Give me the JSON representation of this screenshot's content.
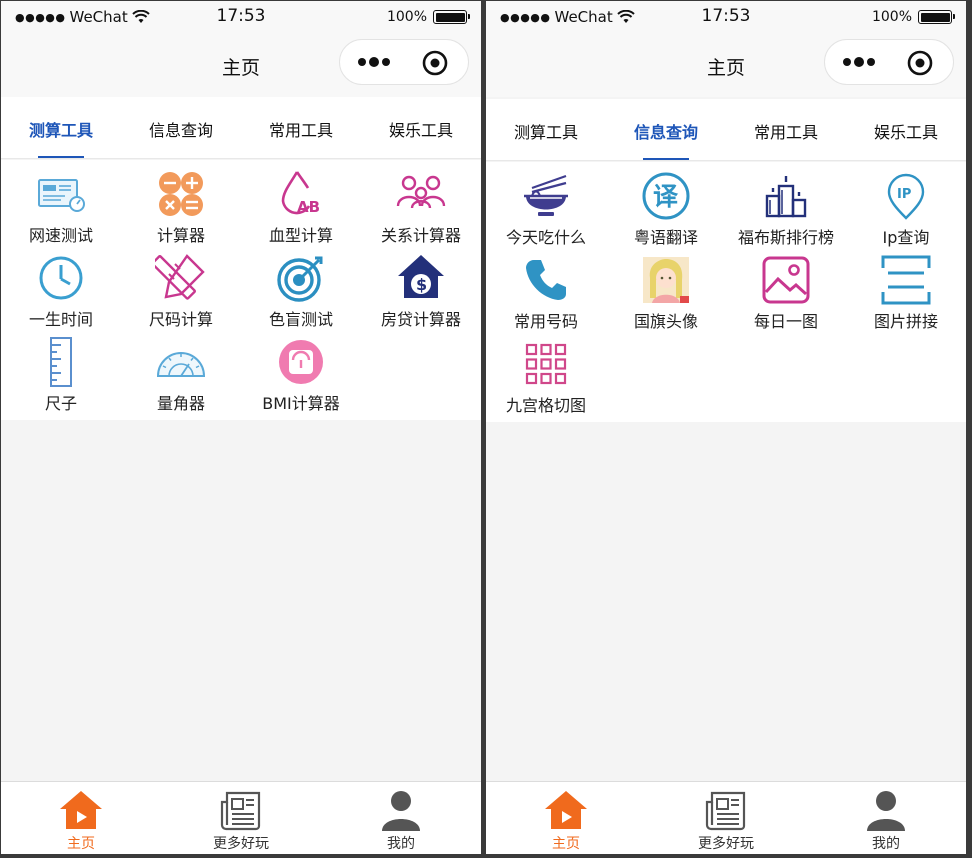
{
  "status_bar": {
    "signal": "●●●●●",
    "carrier": "WeChat",
    "time": "17:53",
    "battery": "100%",
    "signal_icon": "signal-dots-icon",
    "wifi_icon": "wifi-icon",
    "battery_icon": "battery-icon"
  },
  "nav": {
    "title": "主页",
    "more_icon": "more-dots-icon",
    "target_icon": "target-icon"
  },
  "tabs": [
    "测算工具",
    "信息查询",
    "常用工具",
    "娱乐工具"
  ],
  "left_screen": {
    "active_tab": "测算工具",
    "items": [
      {
        "label": "网速测试",
        "icon": "speed-test-icon"
      },
      {
        "label": "计算器",
        "icon": "calculator-icon"
      },
      {
        "label": "血型计算",
        "icon": "blood-type-icon"
      },
      {
        "label": "关系计算器",
        "icon": "family-icon"
      },
      {
        "label": "一生时间",
        "icon": "clock-icon"
      },
      {
        "label": "尺码计算",
        "icon": "ruler-pencil-icon"
      },
      {
        "label": "色盲测试",
        "icon": "target-dartboard-icon"
      },
      {
        "label": "房贷计算器",
        "icon": "house-dollar-icon"
      },
      {
        "label": "尺子",
        "icon": "ruler-icon"
      },
      {
        "label": "量角器",
        "icon": "protractor-icon"
      },
      {
        "label": "BMI计算器",
        "icon": "scale-icon"
      }
    ]
  },
  "right_screen": {
    "active_tab": "信息查询",
    "items": [
      {
        "label": "今天吃什么",
        "icon": "noodle-bowl-icon"
      },
      {
        "label": "粤语翻译",
        "icon": "translate-icon",
        "glyph": "译"
      },
      {
        "label": "福布斯排行榜",
        "icon": "podium-icon"
      },
      {
        "label": "Ip查询",
        "icon": "ip-location-icon",
        "glyph": "IP"
      },
      {
        "label": "常用号码",
        "icon": "phone-icon"
      },
      {
        "label": "国旗头像",
        "icon": "avatar-portrait-icon"
      },
      {
        "label": "每日一图",
        "icon": "image-icon"
      },
      {
        "label": "图片拼接",
        "icon": "image-stitch-icon"
      },
      {
        "label": "九宫格切图",
        "icon": "nine-grid-icon"
      }
    ]
  },
  "tabbar": [
    {
      "label": "主页",
      "icon": "home-play-icon",
      "active": true
    },
    {
      "label": "更多好玩",
      "icon": "newspaper-icon",
      "active": false
    },
    {
      "label": "我的",
      "icon": "user-icon",
      "active": false
    }
  ],
  "colors": {
    "accent": "#1e56b8",
    "tabbar_active": "#f06a1d",
    "speed_test": "#5aa9d8",
    "calculator": "#f29a5b",
    "blood_type": "#c8378f",
    "family": "#c8378f",
    "clock": "#3a9fd0",
    "ruler_pencil": "#c8378f",
    "dartboard": "#2b8fc1",
    "house": "#23307a",
    "ruler": "#5a8fce",
    "protractor": "#5aa9d8",
    "scale": "#f07bb0",
    "noodle_bowl": "#3f3d8f",
    "translate": "#2f93c4",
    "podium": "#23307a",
    "ip": "#2f93c4",
    "phone": "#2f93c4",
    "image": "#c8378f",
    "image_stitch": "#2f93c4",
    "nine_grid": "#d0478a"
  }
}
